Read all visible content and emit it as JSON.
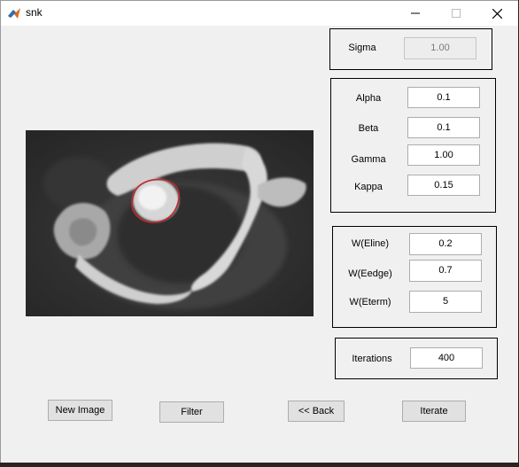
{
  "window": {
    "title": "snk",
    "minimize": "—",
    "maximize": "☐",
    "close": "✕"
  },
  "sigma": {
    "label": "Sigma",
    "value": "1.00"
  },
  "params": {
    "alpha": {
      "label": "Alpha",
      "value": "0.1"
    },
    "beta": {
      "label": "Beta",
      "value": "0.1"
    },
    "gamma": {
      "label": "Gamma",
      "value": "1.00"
    },
    "kappa": {
      "label": "Kappa",
      "value": "0.15"
    }
  },
  "weights": {
    "eline": {
      "label": "W(Eline)",
      "value": "0.2"
    },
    "eedge": {
      "label": "W(Eedge)",
      "value": "0.7"
    },
    "eterm": {
      "label": "W(Eterm)",
      "value": "5"
    }
  },
  "iterations": {
    "label": "Iterations",
    "value": "400"
  },
  "buttons": {
    "new_image": "New Image",
    "filter": "Filter",
    "back": "<< Back",
    "iterate": "Iterate"
  },
  "image": {
    "description_icon": "ct-vertebra-image",
    "contour_color": "#c0262c"
  }
}
